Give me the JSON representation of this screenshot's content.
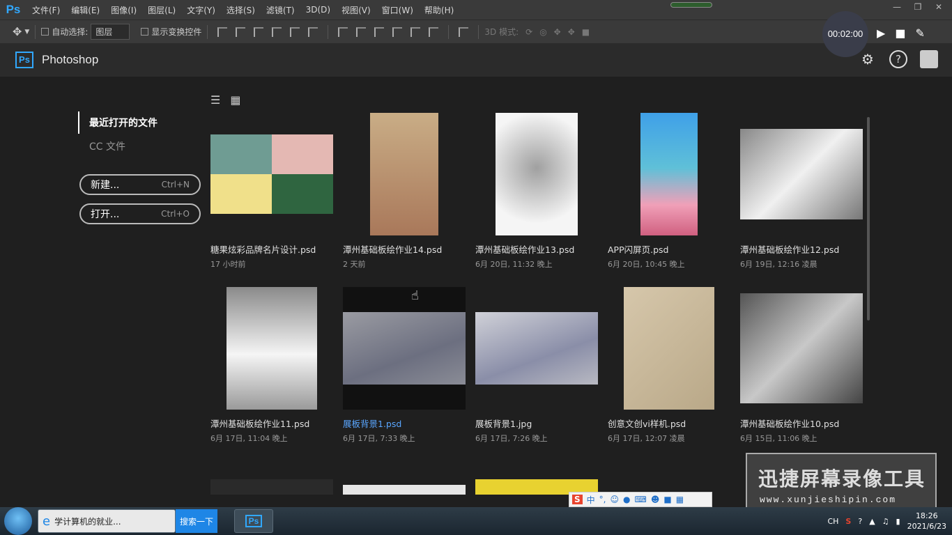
{
  "menubar": {
    "logo": "Ps",
    "items": [
      "文件(F)",
      "编辑(E)",
      "图像(I)",
      "图层(L)",
      "文字(Y)",
      "选择(S)",
      "滤镜(T)",
      "3D(D)",
      "视图(V)",
      "窗口(W)",
      "帮助(H)"
    ]
  },
  "options": {
    "auto_select_label": "自动选择:",
    "layer_select": "图层",
    "show_transform_label": "显示变换控件",
    "mode_3d_label": "3D 模式:"
  },
  "header": {
    "badge": "Ps",
    "title": "Photoshop"
  },
  "recorder": {
    "time": "00:02:00"
  },
  "sidebar": {
    "recent_label": "最近打开的文件",
    "cc_label": "CC 文件",
    "new_label": "新建...",
    "new_shortcut": "Ctrl+N",
    "open_label": "打开...",
    "open_shortcut": "Ctrl+O"
  },
  "files": [
    {
      "name": "糖果炫彩品牌名片设计.psd",
      "date": "17 小时前",
      "colors": [
        "#6f9c93",
        "#e4b8b3",
        "#f0e08a",
        "#2f6540"
      ]
    },
    {
      "name": "潭州基础板绘作业14.psd",
      "date": "2 天前",
      "colors": [
        "#c09070"
      ]
    },
    {
      "name": "潭州基础板绘作业13.psd",
      "date": "6月 20日, 11:32 晚上",
      "colors": [
        "#9a9a9a"
      ]
    },
    {
      "name": "APP闪屏页.psd",
      "date": "6月 20日, 10:45 晚上",
      "colors": [
        "#4aa0e0"
      ]
    },
    {
      "name": "潭州基础板绘作业12.psd",
      "date": "6月 19日, 12:16 凌晨",
      "colors": [
        "#6a6a6a"
      ]
    },
    {
      "name": "潭州基础板绘作业11.psd",
      "date": "6月 17日, 11:04 晚上",
      "colors": [
        "#8a8a8a"
      ]
    },
    {
      "name": "展板背景1.psd",
      "date": "6月 17日, 7:33 晚上",
      "colors": [
        "#8a8c96"
      ]
    },
    {
      "name": "展板背景1.jpg",
      "date": "6月 17日, 7:26 晚上",
      "colors": [
        "#a8a9b4"
      ]
    },
    {
      "name": "创意文创vi样机.psd",
      "date": "6月 17日, 12:07 凌晨",
      "colors": [
        "#c8b89a"
      ]
    },
    {
      "name": "潭州基础板绘作业10.psd",
      "date": "6月 15日, 11:06 晚上",
      "colors": [
        "#7a7a7a"
      ]
    }
  ],
  "taskbar": {
    "browser_task": "学计算机的就业...",
    "search_button": "搜索一下",
    "ps_task": "Ps",
    "lang": "CH",
    "time": "18:26",
    "date": "2021/6/23"
  },
  "ime": {
    "mode": "中"
  },
  "watermark": {
    "title": "迅捷屏幕录像工具",
    "url": "www.xunjieshipin.com"
  }
}
